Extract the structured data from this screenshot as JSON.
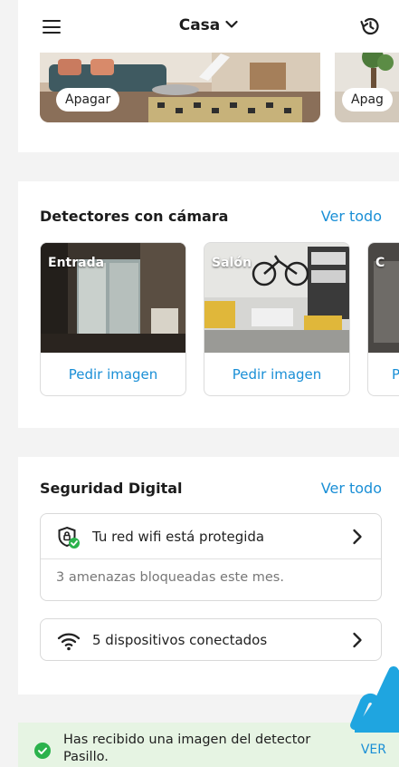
{
  "header": {
    "home_name": "Casa",
    "menu_icon": "hamburger-menu-icon",
    "history_icon": "history-icon"
  },
  "rooms": {
    "items": [
      {
        "button_label": "Apagar"
      },
      {
        "button_label": "Apag"
      }
    ]
  },
  "cameras": {
    "title": "Detectores con cámara",
    "see_all": "Ver todo",
    "items": [
      {
        "label": "Entrada",
        "action": "Pedir imagen"
      },
      {
        "label": "Salón",
        "action": "Pedir imagen"
      },
      {
        "label": "C",
        "action": "P"
      }
    ]
  },
  "digital_security": {
    "title": "Seguridad Digital",
    "see_all": "Ver todo",
    "wifi_status": "Tu red wifi está protegida",
    "threats_blocked": "3 amenazas bloqueadas este mes.",
    "devices_connected": "5 dispositivos conectados"
  },
  "toast": {
    "message": "Has recibido una imagen del detector Pasillo.",
    "action": "VER"
  },
  "colors": {
    "accent": "#1a8fd6",
    "success": "#2bb24c",
    "toast_bg": "#e6f4e3",
    "divider_bg": "#f3f3f3"
  }
}
